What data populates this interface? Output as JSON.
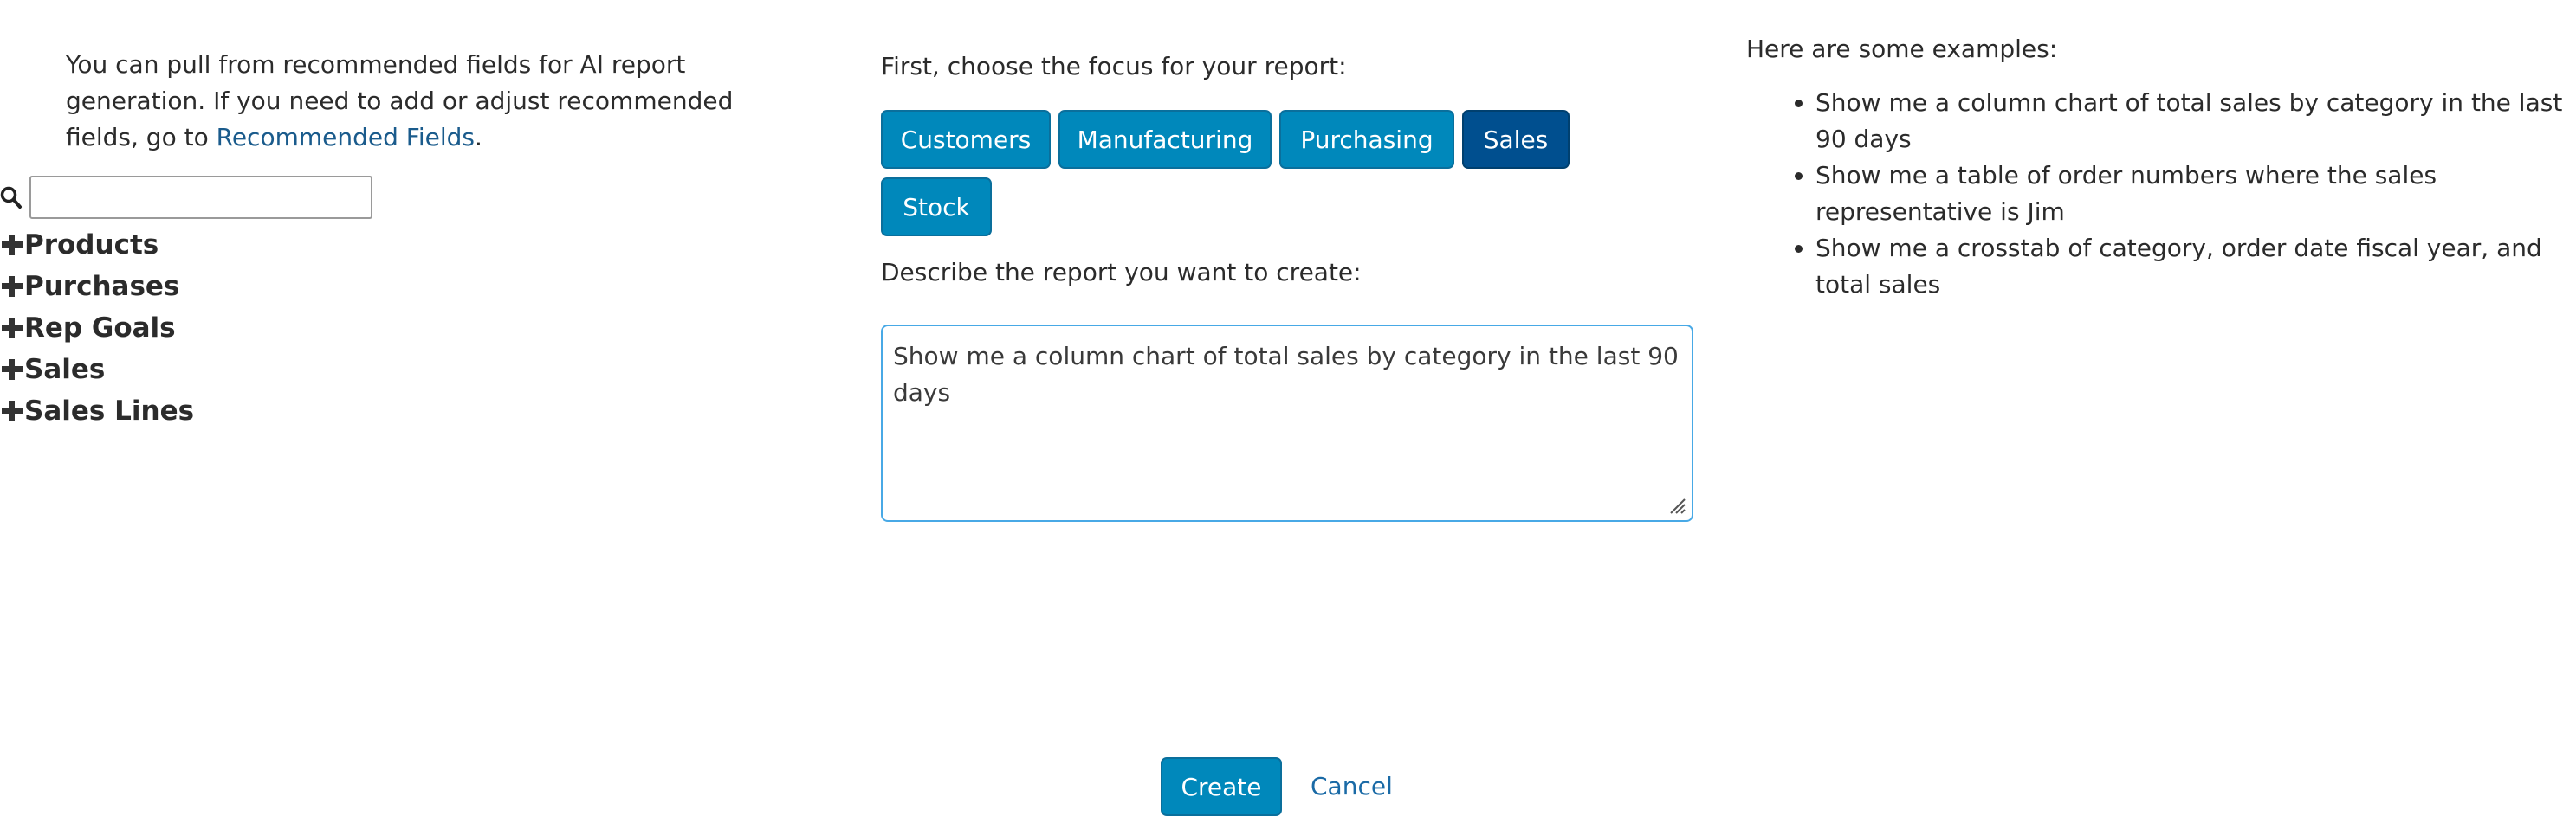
{
  "left_panel": {
    "intro_text": "You can pull from recommended fields for AI report generation. If you need to add or adjust recommended fields, go to ",
    "intro_link": "Recommended Fields",
    "intro_end": ".",
    "search": {
      "value": "",
      "placeholder": ""
    },
    "tree_items": [
      "Products",
      "Purchases",
      "Rep Goals",
      "Sales",
      "Sales Lines"
    ]
  },
  "middle_panel": {
    "focus_label": "First, choose the focus for your report:",
    "focus_buttons": [
      "Customers",
      "Manufacturing",
      "Purchasing",
      "Sales",
      "Stock"
    ],
    "selected_focus": "Sales",
    "describe_label": "Describe the report you want to create:",
    "prompt_value": "Show me a column chart of total sales by category in the last 90 days"
  },
  "right_panel": {
    "heading": "Here are some examples:",
    "examples": [
      "Show me a column chart of total sales by category in the last 90 days",
      "Show me a table of order numbers where the sales representative is Jim",
      "Show me a crosstab of category, order date fiscal year, and total sales"
    ]
  },
  "actions": {
    "create_label": "Create",
    "cancel_label": "Cancel"
  },
  "colors": {
    "button_blue": "#0088bb",
    "selected_blue": "#004f8f",
    "link_blue": "#1a5b8c",
    "focus_border": "#48a9e6"
  },
  "icons": {
    "search": "search-icon",
    "expand": "plus-icon",
    "resize": "resize-grip-icon"
  }
}
